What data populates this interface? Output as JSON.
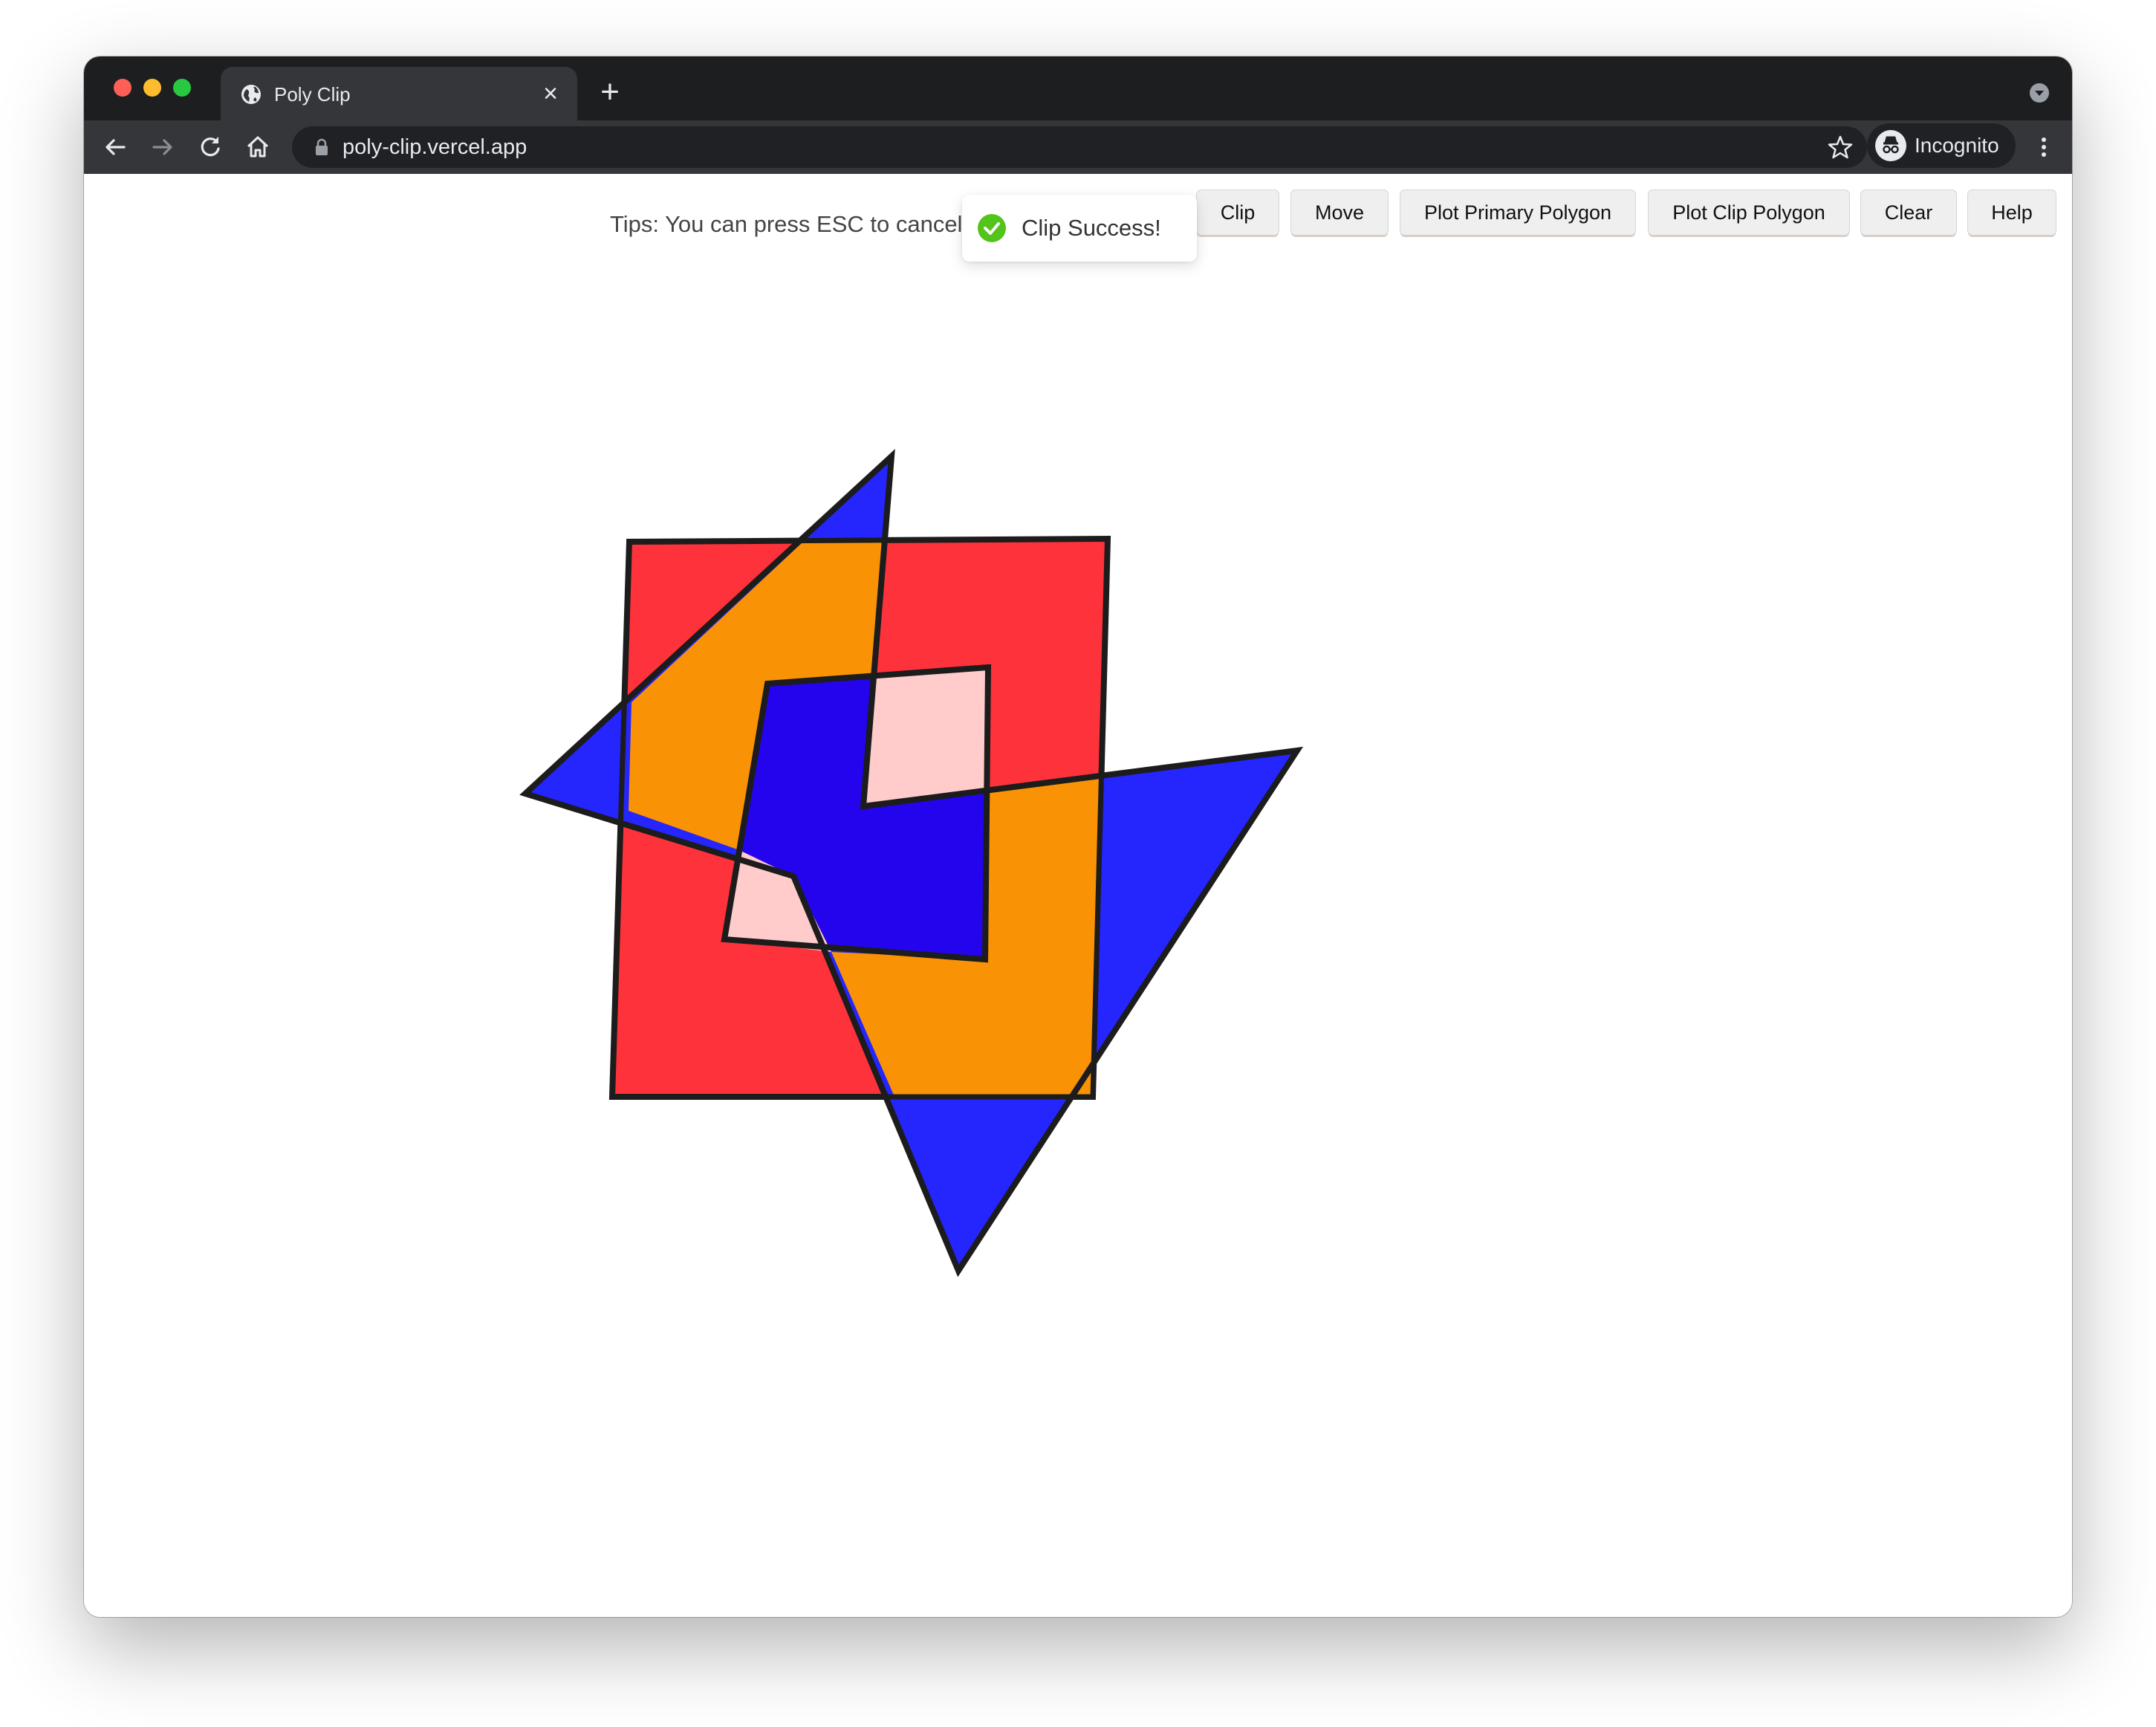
{
  "browser": {
    "tab": {
      "title": "Poly Clip",
      "close_glyph": "×"
    },
    "new_tab_glyph": "+",
    "url": "poly-clip.vercel.app",
    "profile_label": "Incognito",
    "icons": [
      "globe-icon",
      "close-icon",
      "plus-icon",
      "back-icon",
      "forward-icon",
      "reload-icon",
      "home-icon",
      "lock-icon",
      "star-icon",
      "incognito-icon",
      "more-vert-icon",
      "tab-search-icon"
    ]
  },
  "app": {
    "tips": "Tips: You can press ESC to cancel",
    "buttons": {
      "clip": "Clip",
      "move": "Move",
      "plot_primary": "Plot Primary Polygon",
      "plot_clip": "Plot Clip Polygon",
      "clear": "Clear",
      "help": "Help"
    },
    "toast": {
      "message": "Clip Success!",
      "icon": "check-circle-icon",
      "color": "#52c41a"
    },
    "colors": {
      "primary_polygon": "#fe323a",
      "clip_polygon": "#2525fd",
      "clip_result": "#f99205",
      "hole": "#ffcbcb",
      "hole_overlap": "#2404ec",
      "outline": "#1c1c1c"
    }
  }
}
